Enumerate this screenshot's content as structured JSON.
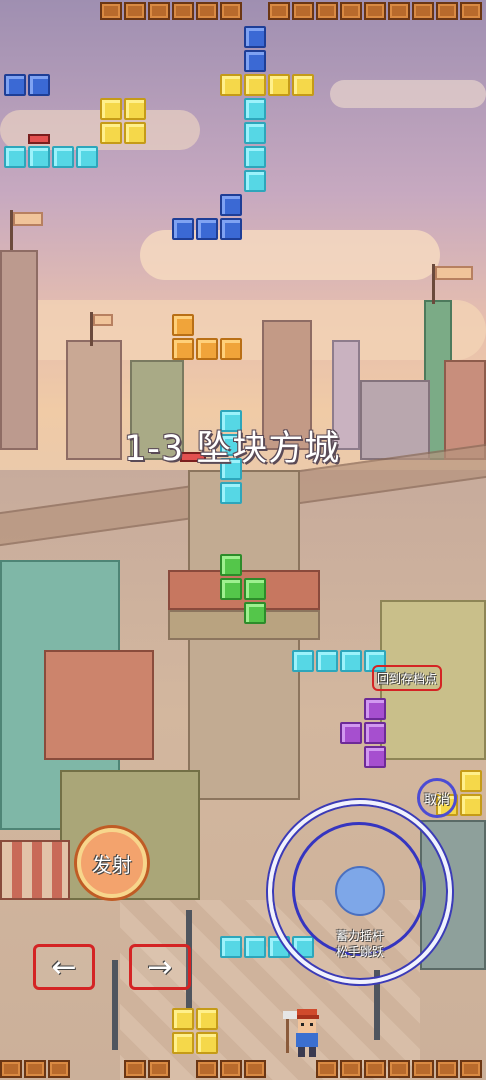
{
  "level": {
    "title": "1-3 坠块方城"
  },
  "controls": {
    "fire_label": "发射",
    "left_label": "←",
    "right_label": "→",
    "save_label": "回到存档点",
    "cancel_label": "取消",
    "joystick_hint_line1": "蓄力摇杆",
    "joystick_hint_line2": "松手跳跃"
  },
  "colors": {
    "cyan": "#56d7e5",
    "blue": "#3b69d4",
    "yellow": "#f5d84a",
    "orange": "#f0a43a",
    "green": "#54c64a",
    "purple": "#a64fcf",
    "brick": "#b86a2c",
    "danger_outline": "#d42424",
    "joystick_outline": "#3b3bb8"
  },
  "icons": [
    "left-arrow-icon",
    "right-arrow-icon",
    "player-character-icon",
    "checkpoint-flag-icon",
    "spring-pad-icon"
  ]
}
